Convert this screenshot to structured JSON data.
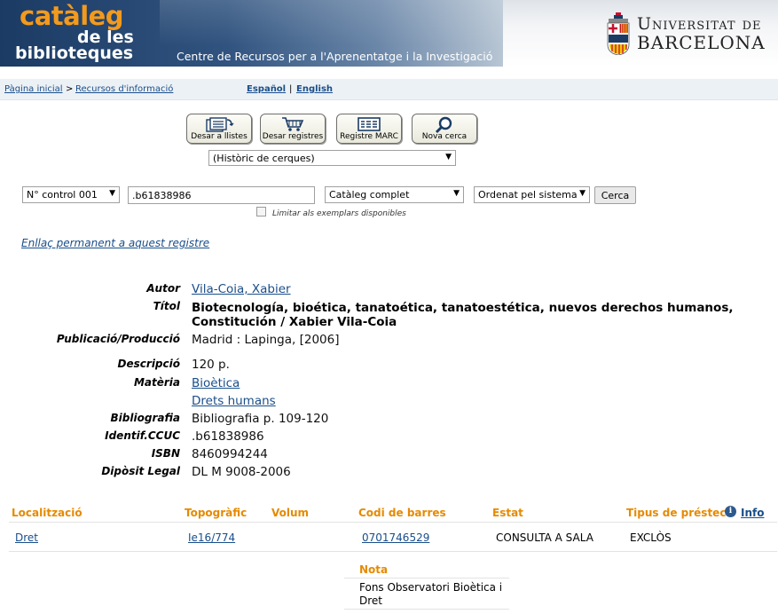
{
  "banner": {
    "logo_line1": "catàleg",
    "logo_line2": "de les",
    "logo_line3": "biblioteques",
    "subtitle": "Centre de Recursos per a l'Aprenentatge i la Investigació",
    "university_line1": "Universitat de",
    "university_line2": "BARCELONA"
  },
  "breadcrumb": {
    "home": "Pàgina inicial",
    "separator": ">",
    "resources": "Recursos d'informació"
  },
  "languages": {
    "spanish": "Español",
    "separator": "|",
    "english": "English"
  },
  "toolbar": {
    "save_lists": "Desar a llistes",
    "save_records": "Desar registres",
    "marc_record": "Registre MARC",
    "new_search": "Nova cerca",
    "history_select": "(Històric de cerques)"
  },
  "search": {
    "field_select": "N° control 001",
    "query_value": ".b61838986",
    "catalog_select": "Catàleg complet",
    "sort_select": "Ordenat pel sistema",
    "search_button": "Cerca",
    "limit_label": "Limitar als exemplars disponibles"
  },
  "permalink": "Enllaç permanent a aquest registre",
  "record": {
    "author_label": "Autor",
    "author_value": "Vila-Coia, Xabier",
    "title_label": "Títol",
    "title_value": "Biotecnología, bioética, tanatoética, tanatoestética, nuevos derechos humanos, Constitución / Xabier Vila-Coia",
    "publication_label": "Publicació/Producció",
    "publication_value": "Madrid : Lapinga, [2006]",
    "description_label": "Descripció",
    "description_value": "120 p.",
    "subject_label": "Matèria",
    "subject_1": "Bioètica",
    "subject_2": "Drets humans",
    "bibliography_label": "Bibliografia",
    "bibliography_value": "Bibliografia p. 109-120",
    "ccuc_label": "Identif.CCUC",
    "ccuc_value": ".b61838986",
    "isbn_label": "ISBN",
    "isbn_value": "8460994244",
    "legal_label": "Dipòsit Legal",
    "legal_value": "DL M 9008-2006"
  },
  "holdings": {
    "headers": {
      "location": "Localització",
      "callnumber": "Topogràfic",
      "volume": "Volum",
      "barcode": "Codi de barres",
      "status": "Estat",
      "loan_type": "Tipus de préstec",
      "info": "Info"
    },
    "row": {
      "location": "Dret",
      "callnumber": "Ie16/774",
      "volume": "",
      "barcode": "0701746529",
      "status": "CONSULTA A SALA",
      "loan_type": "EXCLÒS"
    },
    "note_header": "Nota",
    "note_text": "Fons Observatori Bioètica i Dret"
  },
  "colors": {
    "banner_blue": "#1b3b64",
    "logo_orange": "#f39a1d",
    "link_blue": "#1a4e8a",
    "header_orange": "#e68a00"
  }
}
